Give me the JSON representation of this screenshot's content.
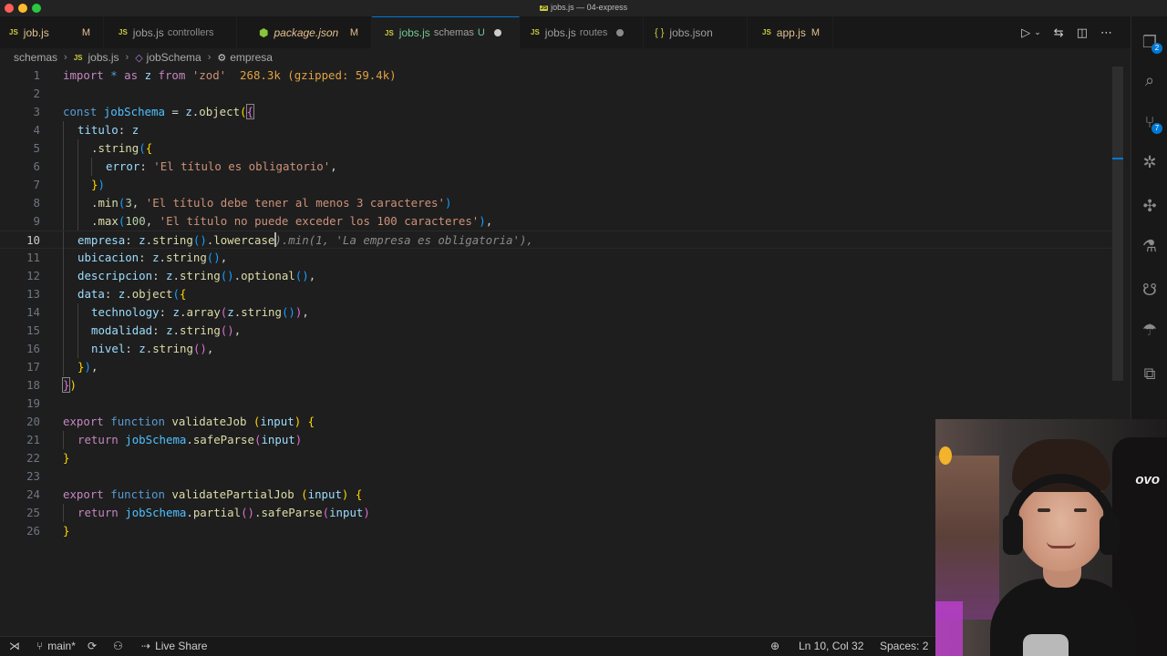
{
  "window": {
    "title": "jobs.js — 04-express",
    "title_icon": "JS"
  },
  "tabs": [
    {
      "icon": "JS",
      "name": "job.js",
      "desc": "",
      "status": "M"
    },
    {
      "icon": "JS",
      "name": "jobs.js",
      "desc": "controllers",
      "status": ""
    },
    {
      "icon": "pkg",
      "name": "package.json",
      "desc": "",
      "status": "M"
    },
    {
      "icon": "JS",
      "name": "jobs.js",
      "desc": "schemas",
      "status": "U",
      "active": true
    },
    {
      "icon": "JS",
      "name": "jobs.js",
      "desc": "routes",
      "status": ""
    },
    {
      "icon": "{ }",
      "name": "jobs.json",
      "desc": "",
      "status": ""
    },
    {
      "icon": "JS",
      "name": "app.js",
      "desc": "",
      "status": "M"
    }
  ],
  "breadcrumbs": {
    "folder": "schemas",
    "file": "jobs.js",
    "symbol1": "jobSchema",
    "symbol2": "empresa",
    "file_icon": "JS"
  },
  "editor": {
    "line_numbers": [
      "1",
      "2",
      "3",
      "4",
      "5",
      "6",
      "7",
      "8",
      "9",
      "10",
      "11",
      "12",
      "13",
      "14",
      "15",
      "16",
      "17",
      "18",
      "19",
      "20",
      "21",
      "22",
      "23",
      "24",
      "25",
      "26"
    ],
    "import_size_hint": "268.3k (gzipped: 59.4k)",
    "ghost_suggestion": ").min(1, 'La empresa es obligatoria'),",
    "strings": {
      "zod": "'zod'",
      "title_required": "'El título es obligatorio'",
      "title_min": "'El título debe tener al menos 3 caracteres'",
      "title_max": "'El título no puede exceder los 100 caracteres'"
    },
    "numbers": {
      "min": "3",
      "max": "100"
    }
  },
  "activity_bar": {
    "icons": [
      "explorer-icon",
      "search-icon",
      "source-control-icon",
      "debug-icon",
      "extensions-icon",
      "testing-icon",
      "github-icon",
      "copilot-icon",
      "remote-icon"
    ],
    "badges": {
      "explorer": "2",
      "source_control": "7"
    }
  },
  "statusbar": {
    "branch": "main*",
    "live_share": "Live Share",
    "position": "Ln 10, Col 32",
    "spaces": "Spaces: 2"
  },
  "webcam": {
    "sign_text": "ovo"
  },
  "colors": {
    "accent": "#0078d4",
    "modified": "#e2c08d",
    "untracked": "#73c991",
    "js_icon": "#cbcb41"
  }
}
